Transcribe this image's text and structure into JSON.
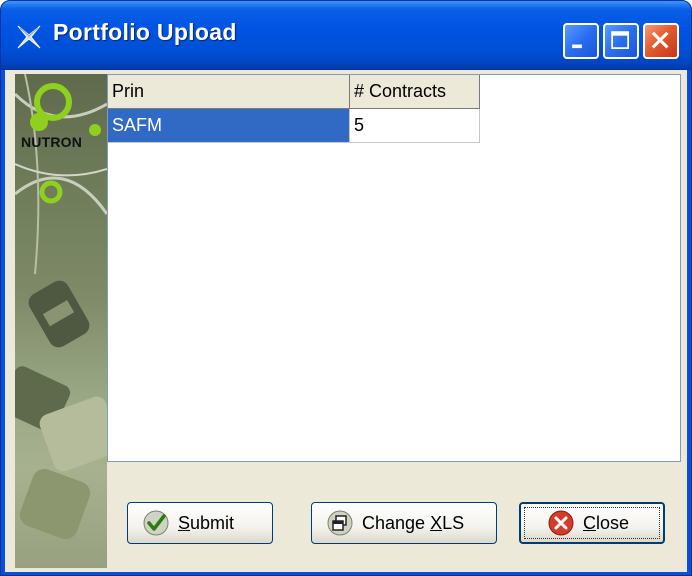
{
  "window": {
    "title": "Portfolio Upload"
  },
  "banner": {
    "brand": "NUTRON"
  },
  "grid": {
    "columns": [
      "Prin",
      "# Contracts"
    ],
    "rows": [
      {
        "prin": "SAFM",
        "contracts": "5"
      }
    ]
  },
  "buttons": {
    "submit": {
      "pre": "",
      "mnemonic": "S",
      "post": "ubmit"
    },
    "change_xls": {
      "pre": "Change ",
      "mnemonic": "X",
      "post": "LS"
    },
    "close": {
      "pre": "",
      "mnemonic": "C",
      "post": "lose"
    }
  },
  "colors": {
    "titlebar": "#0054e3",
    "selection": "#316ac5",
    "close_button": "#e55b2e"
  },
  "icons": {
    "title": "nutron-x-icon",
    "submit": "checkmark-icon",
    "change_xls": "windows-icon",
    "close": "red-x-icon"
  }
}
